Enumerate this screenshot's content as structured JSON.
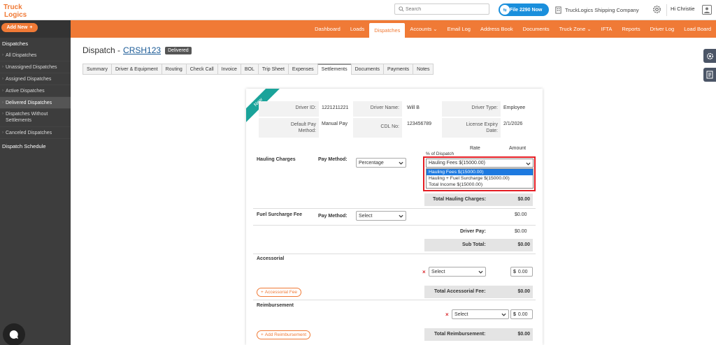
{
  "brand": {
    "logo_text": "Truck Logics",
    "accent": "#f07a36",
    "teal": "#1aa39a"
  },
  "header": {
    "search_placeholder": "Search",
    "file_2290_label": "File 2290 Now",
    "company": "TruckLogics Shipping Company",
    "greeting": "Hi Christie"
  },
  "nav": {
    "add_new": "Add New",
    "items": [
      {
        "label": "Dashboard"
      },
      {
        "label": "Loads"
      },
      {
        "label": "Dispatches"
      },
      {
        "label": "Accounts ⌄"
      },
      {
        "label": "Email Log"
      },
      {
        "label": "Address Book"
      },
      {
        "label": "Documents"
      },
      {
        "label": "Truck Zone ⌄"
      },
      {
        "label": "IFTA"
      },
      {
        "label": "Reports"
      },
      {
        "label": "Driver Log"
      },
      {
        "label": "Load Board"
      }
    ],
    "active": "Dispatches"
  },
  "sidebar": {
    "heading": "Dispatches",
    "items": [
      "All Dispatches",
      "Unassigned Dispatches",
      "Assigned Dispatches",
      "Active Dispatches",
      "Delivered Dispatches",
      "Dispatches Without Settlements",
      "Canceled Dispatches"
    ],
    "active": "Delivered Dispatches",
    "footer": "Dispatch Schedule"
  },
  "page": {
    "title_prefix": "Dispatch - ",
    "dispatch_no": "CRSH123",
    "status": "Delivered"
  },
  "tabs": [
    "Summary",
    "Driver & Equipment",
    "Routing",
    "Check Call",
    "Invoice",
    "BOL",
    "Trip Sheet",
    "Expenses",
    "Settlements",
    "Documents",
    "Payments",
    "Notes"
  ],
  "active_tab": "Settlements",
  "settlement": {
    "ribbon": "New",
    "driver_id_label": "Driver ID:",
    "driver_id": "1221211221",
    "driver_name_label": "Driver Name:",
    "driver_name": "Will B",
    "driver_type_label": "Driver Type:",
    "driver_type": "Employee",
    "pay_method_label": "Default Pay Method:",
    "pay_method": "Manual Pay",
    "cdl_label": "CDL No:",
    "cdl": "123456789",
    "license_label": "License Expiry Date:",
    "license": "2/1/2026",
    "rate_header": "Rate",
    "amount_header": "Amount",
    "pct_label": "% of Dispatch",
    "hauling_label": "Hauling Charges",
    "pay_method_field_label": "Pay Method:",
    "hauling_pay_method": "Percentage",
    "hauling_selected": "Hauling Fees $(15000.00)",
    "hauling_options": [
      "Hauling Fees $(15000.00)",
      "Hauling + Fuel Surcharge $(15000.00)",
      "Total Income $(15000.00)"
    ],
    "total_hauling_label": "Total Hauling Charges:",
    "total_hauling": "$0.00",
    "fuel_label": "Fuel Surcharge Fee",
    "fuel_pay_method": "Select",
    "fuel_amount": "$0.00",
    "driver_pay_label": "Driver Pay:",
    "driver_pay": "$0.00",
    "subtotal_label": "Sub Total:",
    "subtotal": "$0.00",
    "accessorial_label": "Accessorial",
    "accessorial_select": "Select",
    "accessorial_amount": "0.00",
    "add_accessorial": "Accessorial Fee",
    "total_accessorial_label": "Total Accessorial Fee:",
    "total_accessorial": "$0.00",
    "reimbursement_label": "Reimbursement",
    "reimbursement_select": "Select",
    "reimbursement_amount": "0.00",
    "add_reimbursement": "Add Reimbursement",
    "total_reimbursement_label": "Total Reimbursement:",
    "total_reimbursement": "$0.00",
    "dollar": "$",
    "x": "×"
  }
}
